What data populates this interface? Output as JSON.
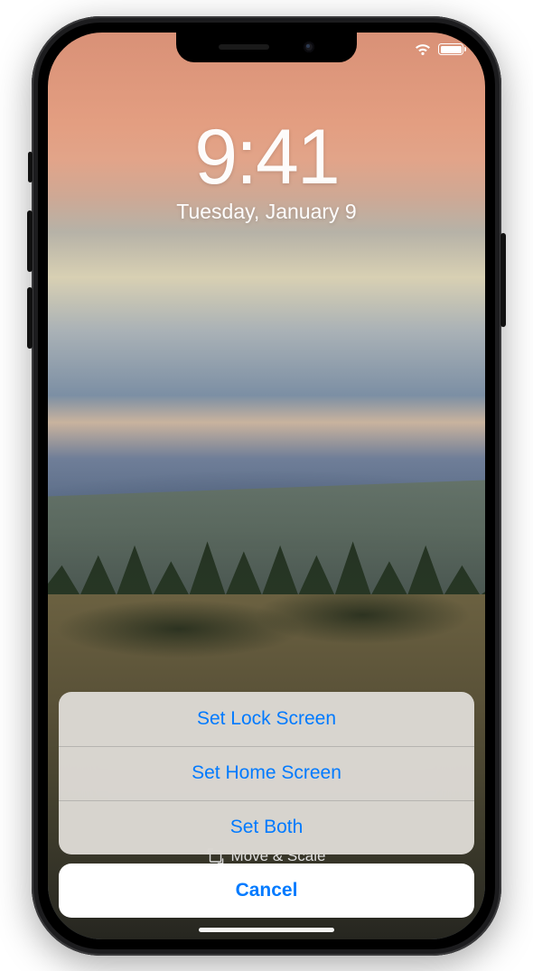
{
  "status": {
    "wifi_icon": "wifi",
    "battery_icon": "battery-full"
  },
  "clock": {
    "time": "9:41",
    "date": "Tuesday, January 9"
  },
  "hint": {
    "icon": "crop-move",
    "label": "Move & Scale"
  },
  "action_sheet": {
    "options": [
      {
        "label": "Set Lock Screen"
      },
      {
        "label": "Set Home Screen"
      },
      {
        "label": "Set Both"
      }
    ],
    "cancel_label": "Cancel"
  },
  "colors": {
    "ios_blue": "#007aff"
  }
}
